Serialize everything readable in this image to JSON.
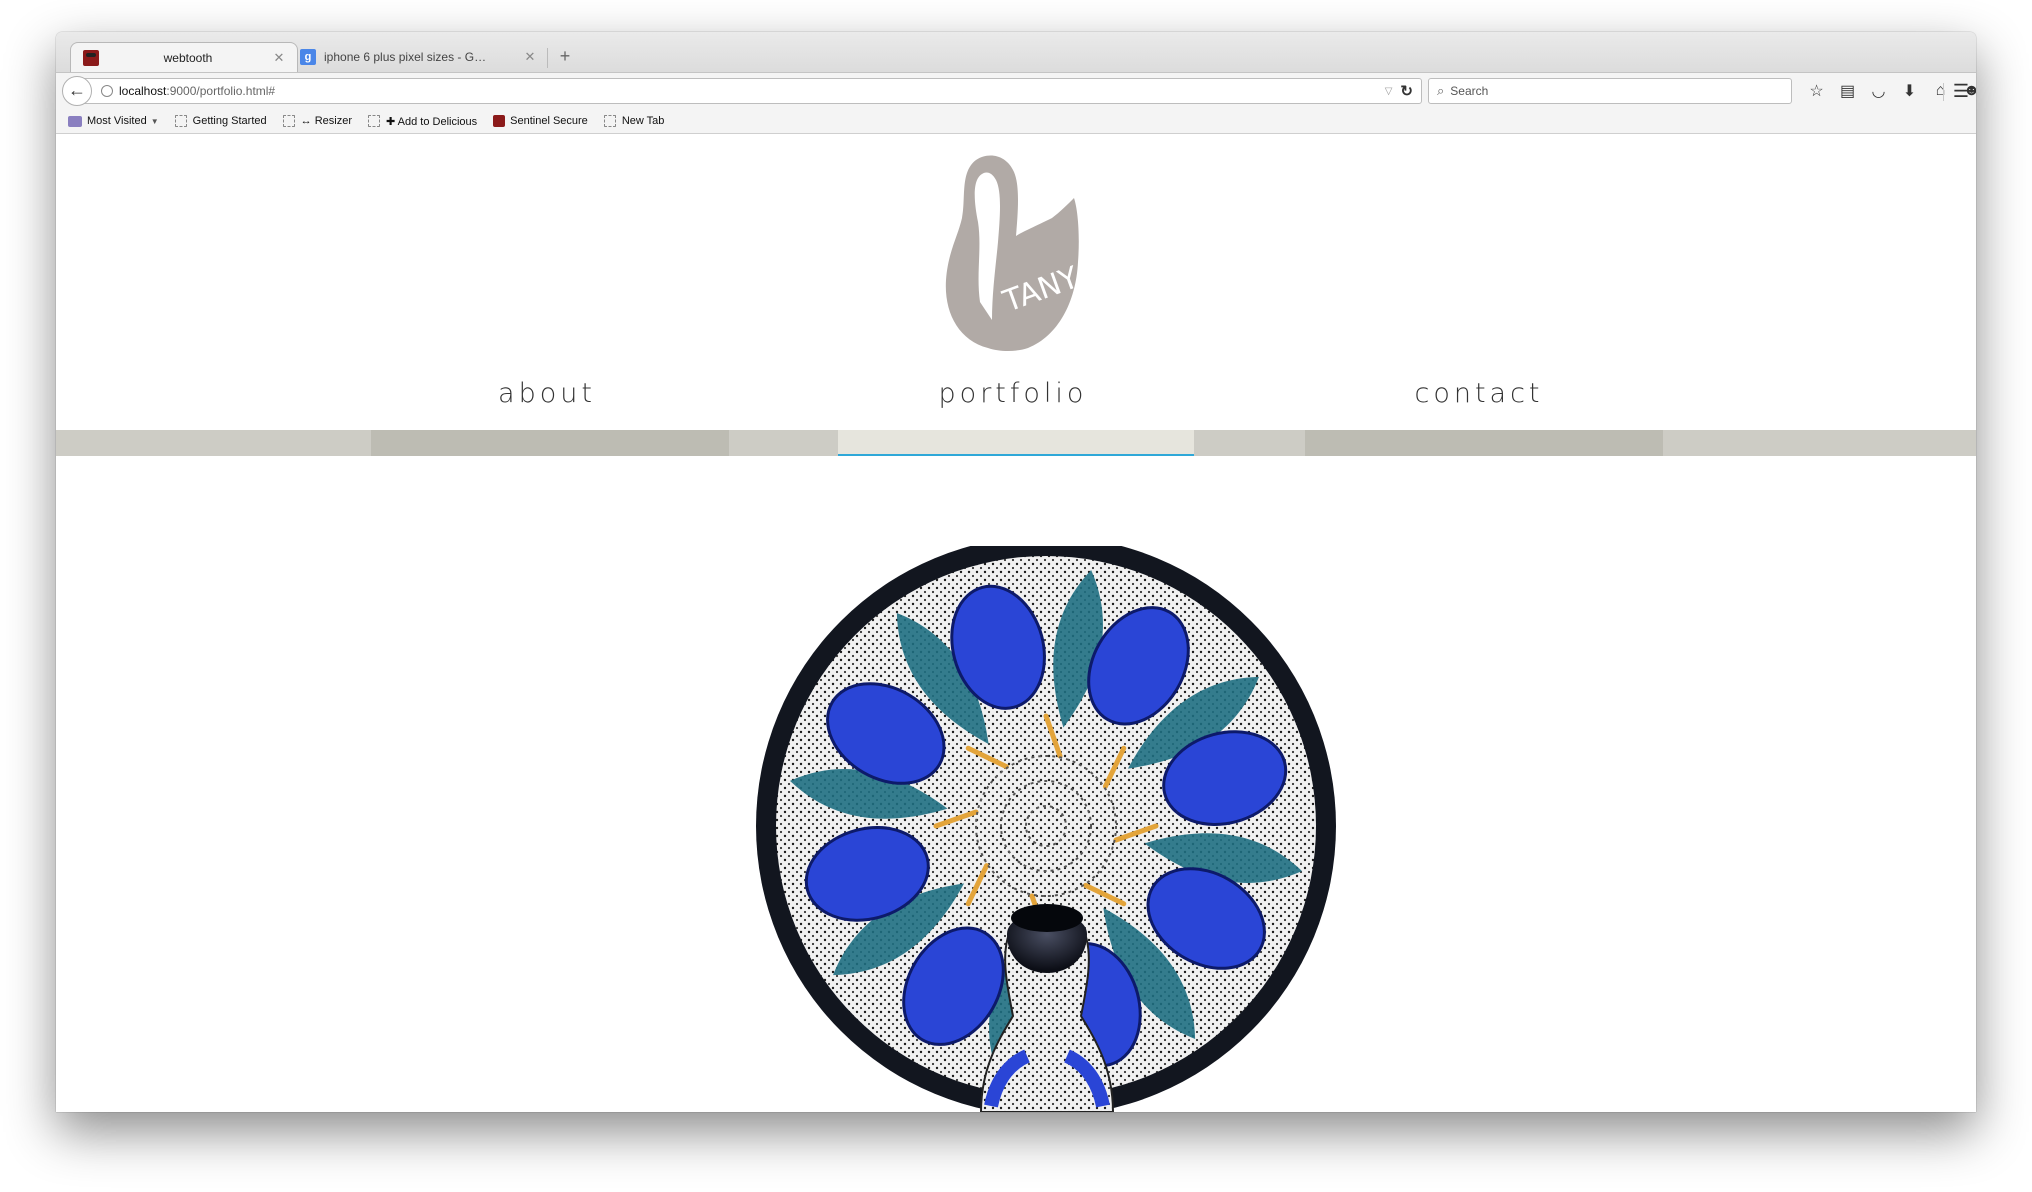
{
  "browser": {
    "tabs": [
      {
        "title": "webtooth",
        "active": true
      },
      {
        "title": "iphone 6 plus pixel sizes - G…",
        "active": false
      }
    ],
    "url": {
      "host": "localhost",
      "path": ":9000/portfolio.html#"
    },
    "search_placeholder": "Search",
    "bookmarks": [
      {
        "label": "Most Visited",
        "icon": "folder-icon"
      },
      {
        "label": "Getting Started",
        "icon": "bookmark-icon"
      },
      {
        "label": "↔ Resizer",
        "icon": "bookmark-icon"
      },
      {
        "label": "✚ Add to Delicious",
        "icon": "bookmark-icon"
      },
      {
        "label": "Sentinel Secure",
        "icon": "sentinel-icon"
      },
      {
        "label": "New Tab",
        "icon": "bookmark-icon"
      }
    ]
  },
  "site": {
    "logo_text": "TANYA",
    "nav": [
      {
        "label": "about",
        "active": false
      },
      {
        "label": "portfolio",
        "active": true
      },
      {
        "label": "contact",
        "active": false
      }
    ],
    "colors": {
      "strip": "#cdccc5",
      "tab_segment": "#bdbcb3",
      "active_segment": "#e6e5dd",
      "active_underline": "#2fa8d8",
      "logo": "#b1aaa6"
    }
  }
}
